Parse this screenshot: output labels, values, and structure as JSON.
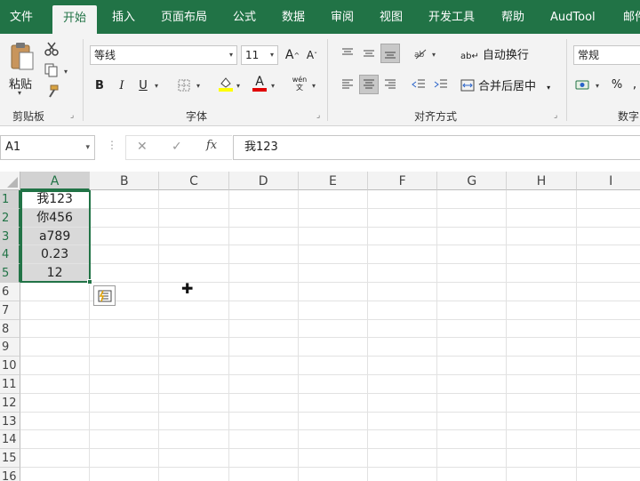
{
  "tabs": [
    "文件",
    "开始",
    "插入",
    "页面布局",
    "公式",
    "数据",
    "审阅",
    "视图",
    "开发工具",
    "帮助",
    "AudTool",
    "邮件"
  ],
  "active_tab": "开始",
  "clipboard": {
    "paste_label": "粘贴",
    "group_label": "剪贴板"
  },
  "font": {
    "name": "等线",
    "size": "11",
    "group_label": "字体",
    "bold": "B",
    "italic": "I",
    "underline": "U",
    "grow": "A",
    "shrink": "A",
    "font_color_glyph": "A",
    "phonetic": "wén 文"
  },
  "alignment": {
    "wrap_label": "自动换行",
    "merge_label": "合并后居中",
    "group_label": "对齐方式"
  },
  "number": {
    "format": "常规",
    "percent": "%",
    "group_label": "数字"
  },
  "formula_bar": {
    "name_box": "A1",
    "cancel": "✕",
    "confirm": "✓",
    "fx": "fx",
    "value": "我123"
  },
  "columns": [
    "A",
    "B",
    "C",
    "D",
    "E",
    "F",
    "G",
    "H",
    "I"
  ],
  "rows": [
    "1",
    "2",
    "3",
    "4",
    "5",
    "6",
    "7",
    "8",
    "9",
    "10",
    "11",
    "12",
    "13",
    "14",
    "15",
    "16"
  ],
  "cells": {
    "A1": "我123",
    "A2": "你456",
    "A3": "a789",
    "A4": "0.23",
    "A5": "12"
  },
  "accent": "#217346"
}
